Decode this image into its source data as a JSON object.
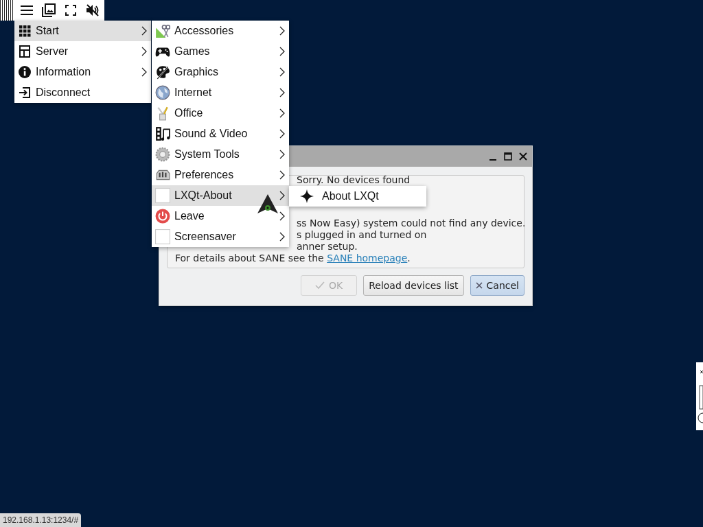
{
  "main_menu": {
    "items": [
      {
        "label": "Start",
        "selected": true,
        "has_submenu": true
      },
      {
        "label": "Server",
        "selected": false,
        "has_submenu": true
      },
      {
        "label": "Information",
        "selected": false,
        "has_submenu": true
      },
      {
        "label": "Disconnect",
        "selected": false,
        "has_submenu": false
      }
    ]
  },
  "start_menu": {
    "items": [
      {
        "label": "Accessories",
        "selected": false,
        "has_submenu": true
      },
      {
        "label": "Games",
        "selected": false,
        "has_submenu": true
      },
      {
        "label": "Graphics",
        "selected": false,
        "has_submenu": true
      },
      {
        "label": "Internet",
        "selected": false,
        "has_submenu": true
      },
      {
        "label": "Office",
        "selected": false,
        "has_submenu": true
      },
      {
        "label": "Sound & Video",
        "selected": false,
        "has_submenu": true
      },
      {
        "label": "System Tools",
        "selected": false,
        "has_submenu": true
      },
      {
        "label": "Preferences",
        "selected": false,
        "has_submenu": true
      },
      {
        "label": "LXQt-About",
        "selected": true,
        "has_submenu": true
      },
      {
        "label": "Leave",
        "selected": false,
        "has_submenu": true
      },
      {
        "label": "Screensaver",
        "selected": false,
        "has_submenu": true
      }
    ]
  },
  "about_menu": {
    "items": [
      {
        "label": "About LXQt",
        "selected": false
      }
    ]
  },
  "dialog": {
    "message_lines": [
      "Sorry. No devices found",
      "ss Now Easy) system could not find any device.",
      "s plugged in and turned on",
      "anner setup."
    ],
    "details_prefix": "For details about SANE see the ",
    "details_link": "SANE homepage",
    "details_suffix": ".",
    "buttons": [
      {
        "label": "OK",
        "kind": "ok",
        "disabled": true,
        "focused": false
      },
      {
        "label": "Reload devices list",
        "kind": "plain",
        "disabled": false,
        "focused": false
      },
      {
        "label": "Cancel",
        "kind": "cancel",
        "disabled": false,
        "focused": true
      }
    ]
  },
  "status_bar": {
    "url": "192.168.1.13:1234/#"
  }
}
